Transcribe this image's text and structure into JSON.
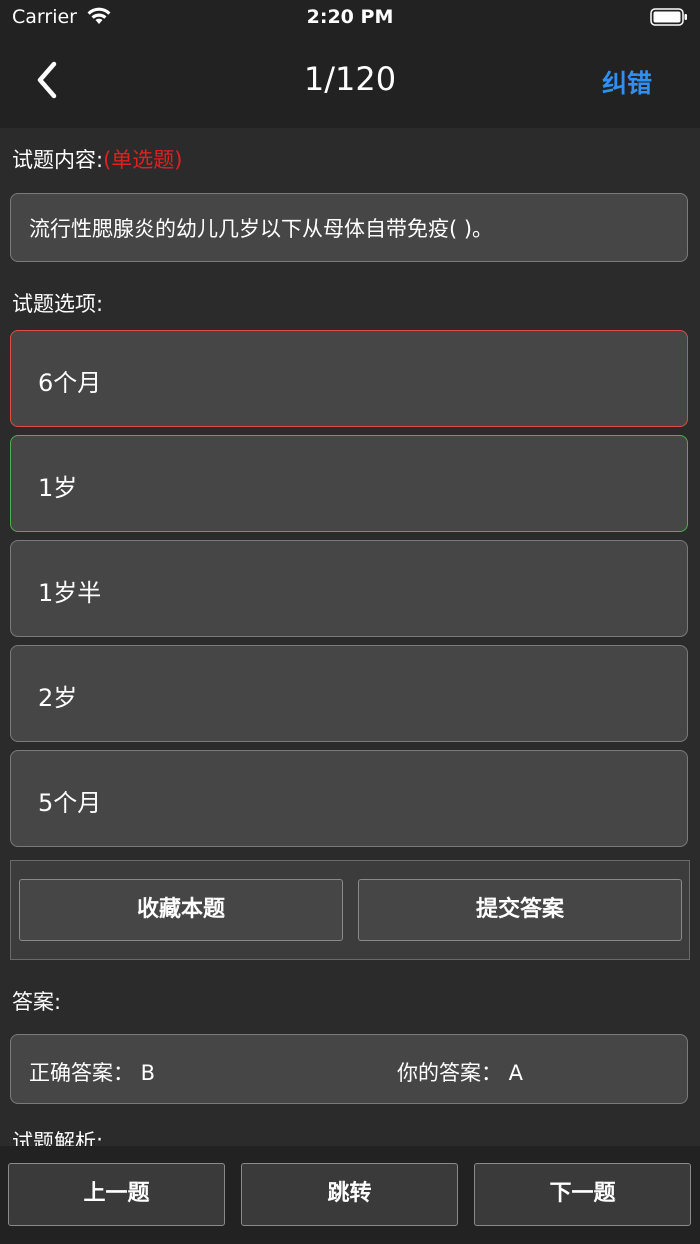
{
  "status_bar": {
    "carrier": "Carrier",
    "time": "2:20 PM"
  },
  "nav": {
    "title": "1/120",
    "right_action": "纠错",
    "accent_color": "#2f8ff2"
  },
  "question": {
    "content_label": "试题内容:",
    "type": "(单选题)",
    "text": "流行性腮腺炎的幼儿几岁以下从母体自带免疫(    )。",
    "options_label": "试题选项:",
    "options": [
      {
        "label": "6个月",
        "state": "wrong-selected"
      },
      {
        "label": "1岁",
        "state": "correct"
      },
      {
        "label": "1岁半",
        "state": "normal"
      },
      {
        "label": "2岁",
        "state": "normal"
      },
      {
        "label": "5个月",
        "state": "normal"
      }
    ]
  },
  "actions": {
    "favorite": "收藏本题",
    "submit": "提交答案"
  },
  "answer": {
    "label": "答案:",
    "correct_prefix": "正确答案：  B",
    "yours_prefix": "你的答案：  A"
  },
  "analysis": {
    "label": "试题解析:"
  },
  "bottom": {
    "prev": "上一题",
    "jump": "跳转",
    "next": "下一题"
  },
  "colors": {
    "wrong": "#d9503f",
    "correct": "#4cae4c",
    "type_red": "#e02020"
  }
}
